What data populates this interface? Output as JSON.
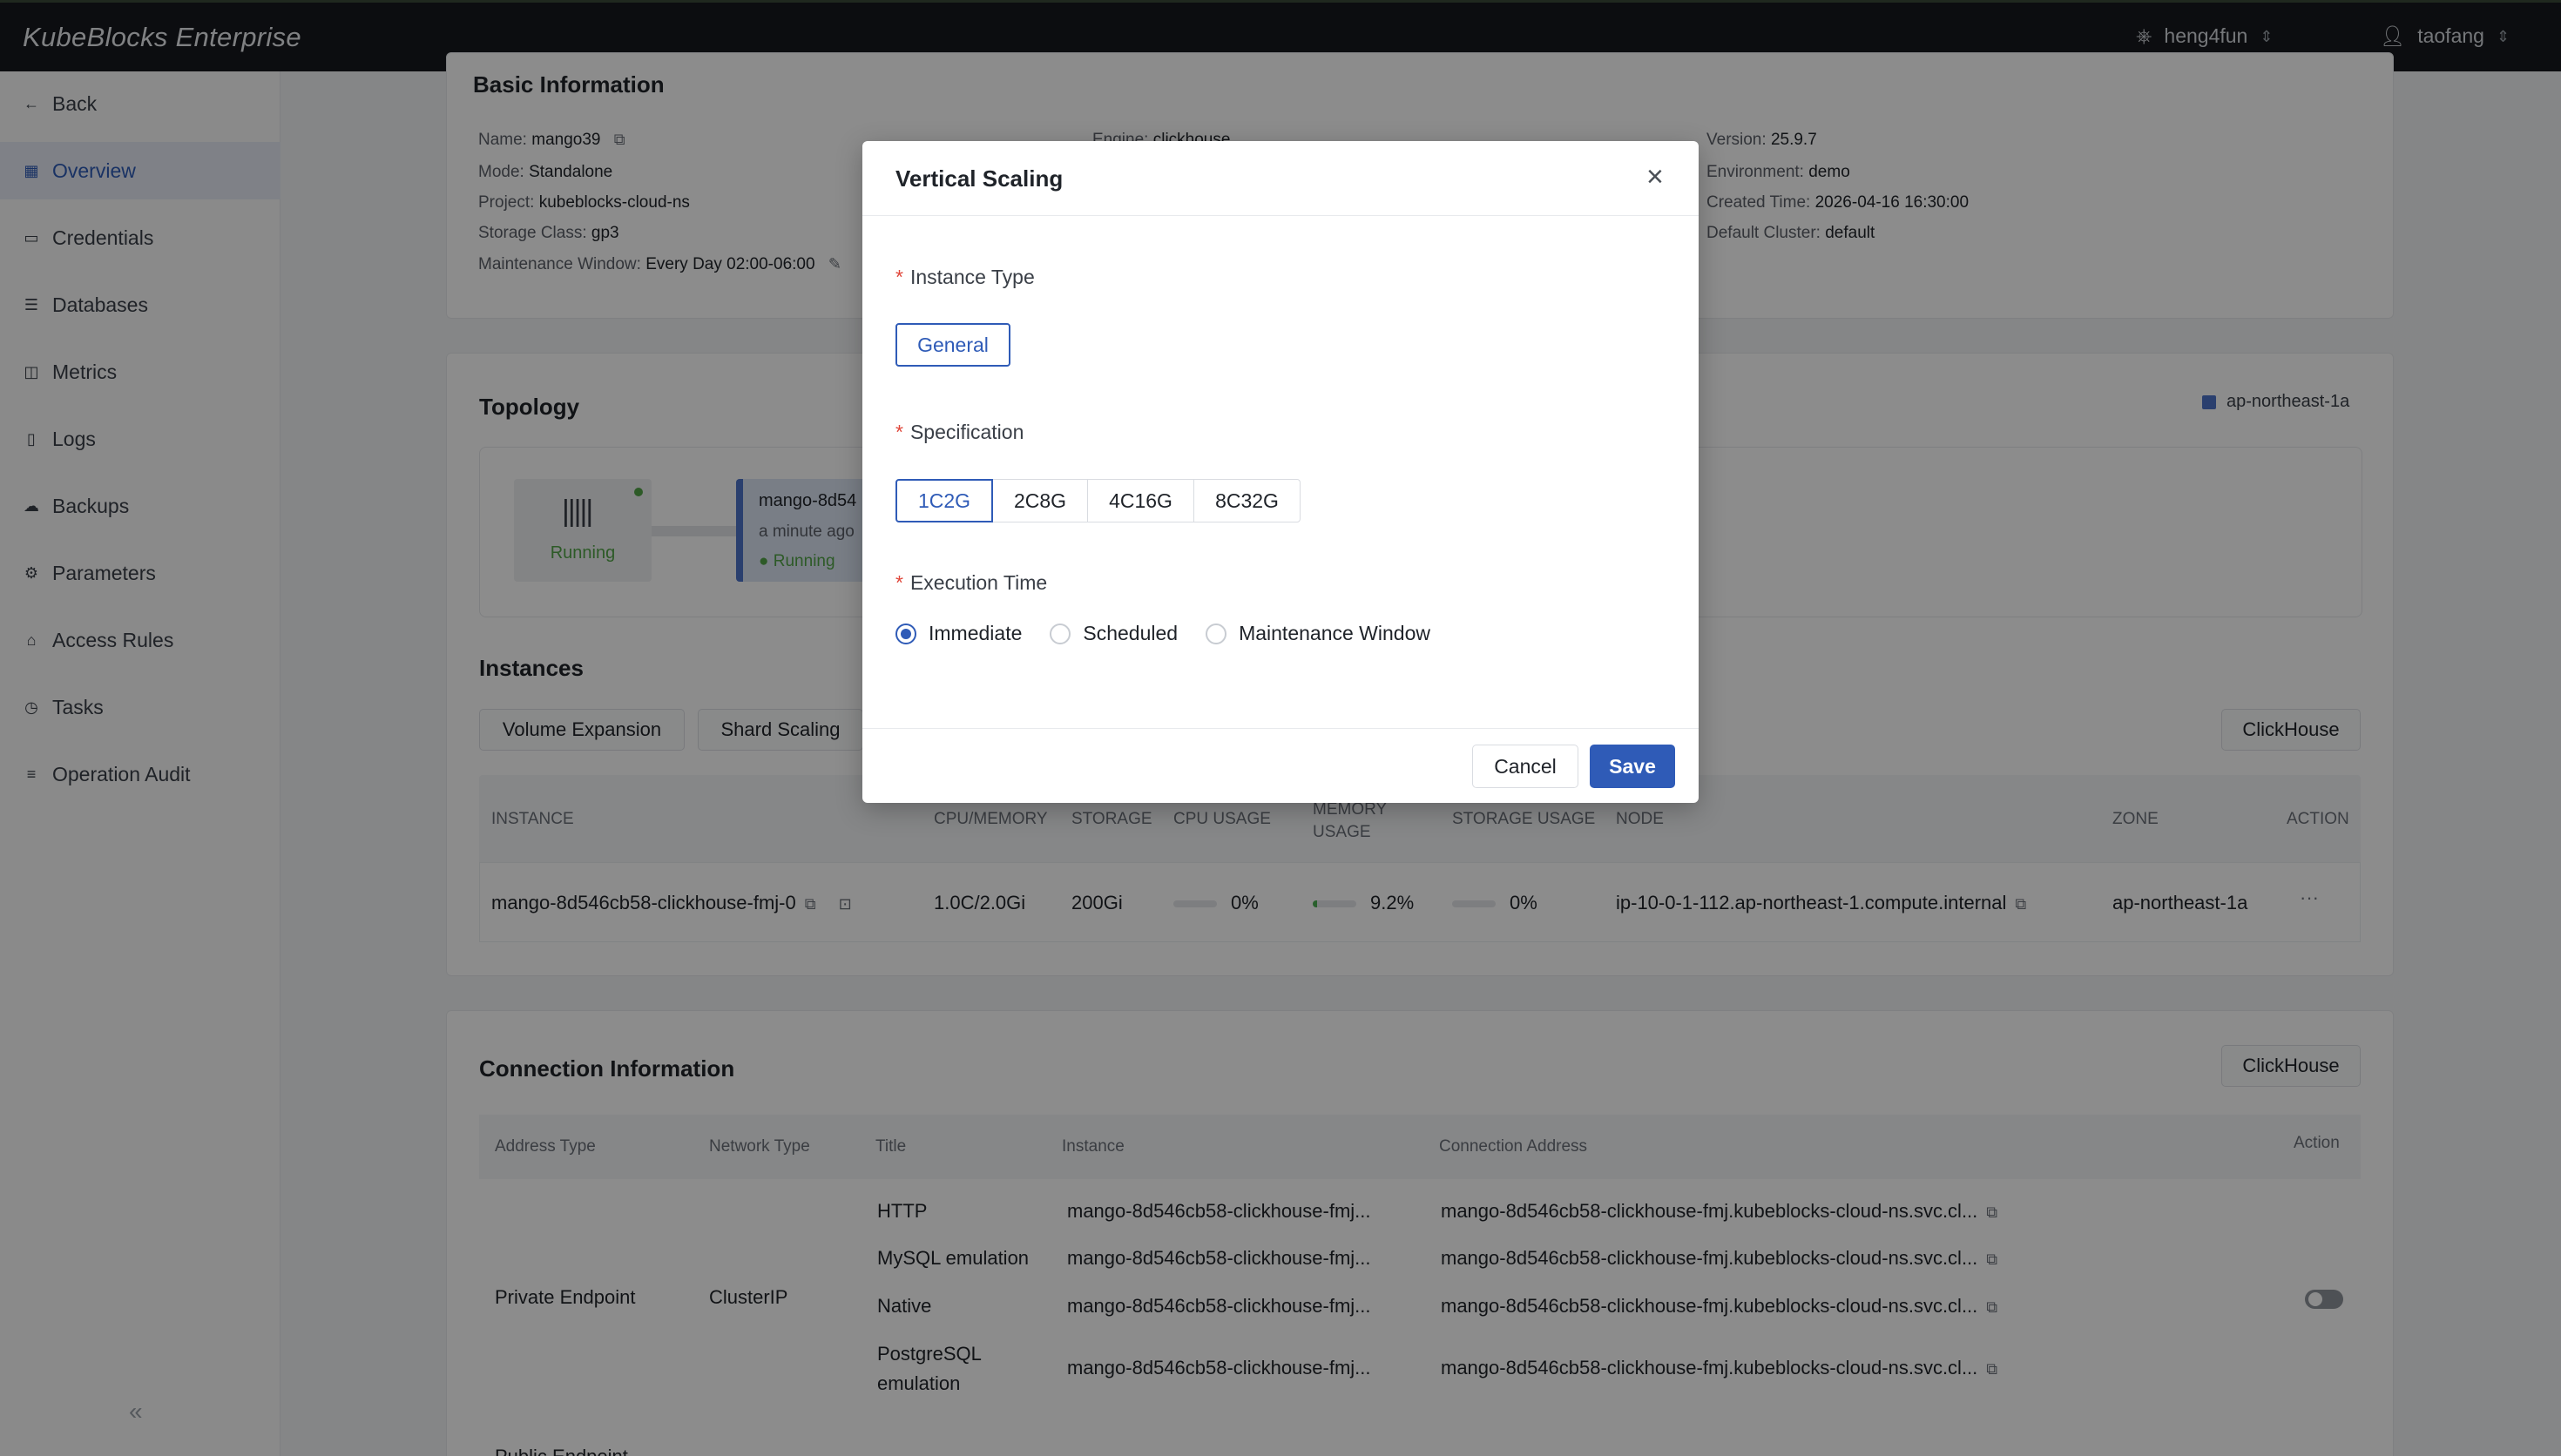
{
  "header": {
    "brand": "KubeBlocks Enterprise",
    "org": "heng4fun",
    "user": "taofang"
  },
  "sidebar": {
    "back": "Back",
    "items": [
      {
        "label": "Overview",
        "icon": "grid-icon"
      },
      {
        "label": "Credentials",
        "icon": "credential-icon"
      },
      {
        "label": "Databases",
        "icon": "database-icon"
      },
      {
        "label": "Metrics",
        "icon": "chart-icon"
      },
      {
        "label": "Logs",
        "icon": "document-icon"
      },
      {
        "label": "Backups",
        "icon": "cloud-icon"
      },
      {
        "label": "Parameters",
        "icon": "gear-icon"
      },
      {
        "label": "Access Rules",
        "icon": "network-icon"
      },
      {
        "label": "Tasks",
        "icon": "clock-icon"
      },
      {
        "label": "Operation Audit",
        "icon": "list-icon"
      }
    ],
    "collapse": "«"
  },
  "basic_info": {
    "title": "Basic Information",
    "name_label": "Name:",
    "name": "mango39",
    "engine_label": "Engine:",
    "engine": "clickhouse",
    "version_label": "Version:",
    "version": "25.9.7",
    "mode_label": "Mode:",
    "mode": "Standalone",
    "environment_label": "Environment:",
    "environment": "demo",
    "project_label": "Project:",
    "project": "kubeblocks-cloud-ns",
    "created_label": "Created Time:",
    "created": "2026-04-16 16:30:00",
    "storage_class_label": "Storage Class:",
    "storage_class": "gp3",
    "default_cluster_label": "Default Cluster:",
    "default_cluster": "default",
    "maintenance_label": "Maintenance Window:",
    "maintenance": "Every Day 02:00-06:00"
  },
  "topology": {
    "title": "Topology",
    "zone": "ap-northeast-1a",
    "service_status": "Running",
    "instance_name": "mango-8d54",
    "instance_time": "a minute ago",
    "instance_status": "Running"
  },
  "instances": {
    "title": "Instances",
    "volume_expansion": "Volume Expansion",
    "shard_scaling": "Shard Scaling",
    "component": "ClickHouse",
    "headers": {
      "instance": "INSTANCE",
      "cpu_memory": "CPU/MEMORY",
      "storage": "STORAGE",
      "cpu_usage": "CPU USAGE",
      "memory_usage": "MEMORY USAGE",
      "storage_usage": "STORAGE USAGE",
      "node": "NODE",
      "zone": "ZONE",
      "action": "ACTION"
    },
    "row": {
      "instance": "mango-8d546cb58-clickhouse-fmj-0",
      "cpu_memory": "1.0C/2.0Gi",
      "storage": "200Gi",
      "cpu_usage": "0%",
      "cpu_usage_value": 0,
      "memory_usage": "9.2%",
      "memory_usage_value": 0.092,
      "storage_usage": "0%",
      "storage_usage_value": 0,
      "node": "ip-10-0-1-112.ap-northeast-1.compute.internal",
      "zone": "ap-northeast-1a",
      "action": "···"
    }
  },
  "connection": {
    "title": "Connection Information",
    "component": "ClickHouse",
    "headers": {
      "address_type": "Address Type",
      "network_type": "Network Type",
      "title": "Title",
      "instance": "Instance",
      "address": "Connection Address",
      "action": "Action"
    },
    "private": {
      "address_type": "Private Endpoint",
      "network_type": "ClusterIP",
      "rows": [
        {
          "title": "HTTP",
          "instance": "mango-8d546cb58-clickhouse-fmj...",
          "address": "mango-8d546cb58-clickhouse-fmj.kubeblocks-cloud-ns.svc.cl..."
        },
        {
          "title": "MySQL emulation",
          "instance": "mango-8d546cb58-clickhouse-fmj...",
          "address": "mango-8d546cb58-clickhouse-fmj.kubeblocks-cloud-ns.svc.cl..."
        },
        {
          "title": "Native",
          "instance": "mango-8d546cb58-clickhouse-fmj...",
          "address": "mango-8d546cb58-clickhouse-fmj.kubeblocks-cloud-ns.svc.cl..."
        },
        {
          "title": "PostgreSQL",
          "title2": "emulation",
          "instance": "mango-8d546cb58-clickhouse-fmj...",
          "address": "mango-8d546cb58-clickhouse-fmj.kubeblocks-cloud-ns.svc.cl..."
        }
      ]
    },
    "public_label": "Public Endpoint"
  },
  "modal": {
    "title": "Vertical Scaling",
    "instance_type_label": "Instance Type",
    "instance_type": "General",
    "specification_label": "Specification",
    "specs": [
      "1C2G",
      "2C8G",
      "4C16G",
      "8C32G"
    ],
    "execution_label": "Execution Time",
    "options": [
      "Immediate",
      "Scheduled",
      "Maintenance Window"
    ],
    "cancel": "Cancel",
    "save": "Save",
    "required_mark": "*"
  },
  "colors": {
    "accent": "#2f5bb7",
    "topbar": "#16191e",
    "running": "#52a447"
  }
}
